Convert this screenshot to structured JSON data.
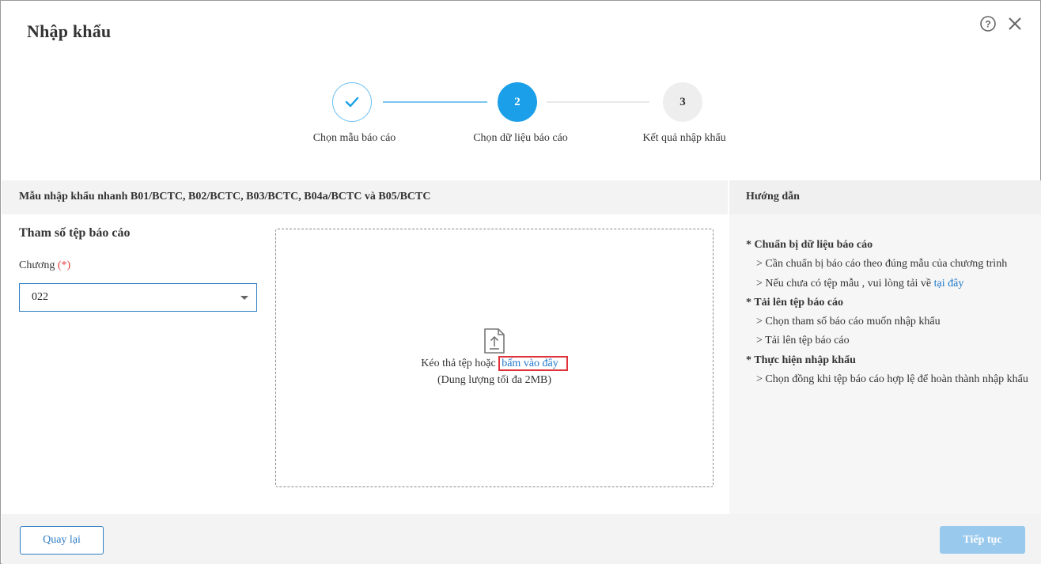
{
  "dialog": {
    "title": "Nhập khẩu"
  },
  "stepper": {
    "steps": [
      {
        "number": "",
        "label": "Chọn mẫu báo cáo",
        "state": "done"
      },
      {
        "number": "2",
        "label": "Chọn dữ liệu báo cáo",
        "state": "active"
      },
      {
        "number": "3",
        "label": "Kết quả nhập khẩu",
        "state": "pending"
      }
    ]
  },
  "template_header": "Mẫu nhập khẩu nhanh B01/BCTC, B02/BCTC, B03/BCTC, B04a/BCTC và B05/BCTC",
  "params": {
    "title": "Tham số tệp báo cáo",
    "chapter_label": "Chương",
    "required_mark": "(*)",
    "chapter_value": "022"
  },
  "dropzone": {
    "text_before": "Kéo thả tệp hoặc ",
    "link_text": "bấm vào đây",
    "limit_text": "(Dung lượng tối đa 2MB)"
  },
  "guide": {
    "title": "Hướng dẫn",
    "section1_head": "* Chuẩn bị dữ liệu báo cáo",
    "section1_item1": "> Cần chuẩn bị báo cáo theo đúng mẫu của chương trình",
    "section1_item2_text": "> Nếu chưa có tệp mẫu , vui lòng tải về ",
    "section1_item2_link": "tại đây",
    "section2_head": "* Tải lên tệp báo cáo",
    "section2_item1": "> Chọn tham số báo cáo muốn nhập khẩu",
    "section2_item2": "> Tải lên tệp báo cáo",
    "section3_head": "* Thực hiện nhập khẩu",
    "section3_item1": "> Chọn đồng khi tệp báo cáo hợp lệ để hoàn thành nhập khẩu"
  },
  "footer": {
    "back_label": "Quay lại",
    "next_label": "Tiếp tục"
  },
  "colors": {
    "accent": "#1a9fe8",
    "link": "#1f78c9",
    "required": "#e03b3b",
    "disabled_button": "#99c9ec"
  },
  "icons": {
    "help": "help-circle-icon",
    "close": "close-icon",
    "step_done": "check-icon",
    "upload": "file-upload-icon",
    "dropdown": "caret-down-icon"
  }
}
